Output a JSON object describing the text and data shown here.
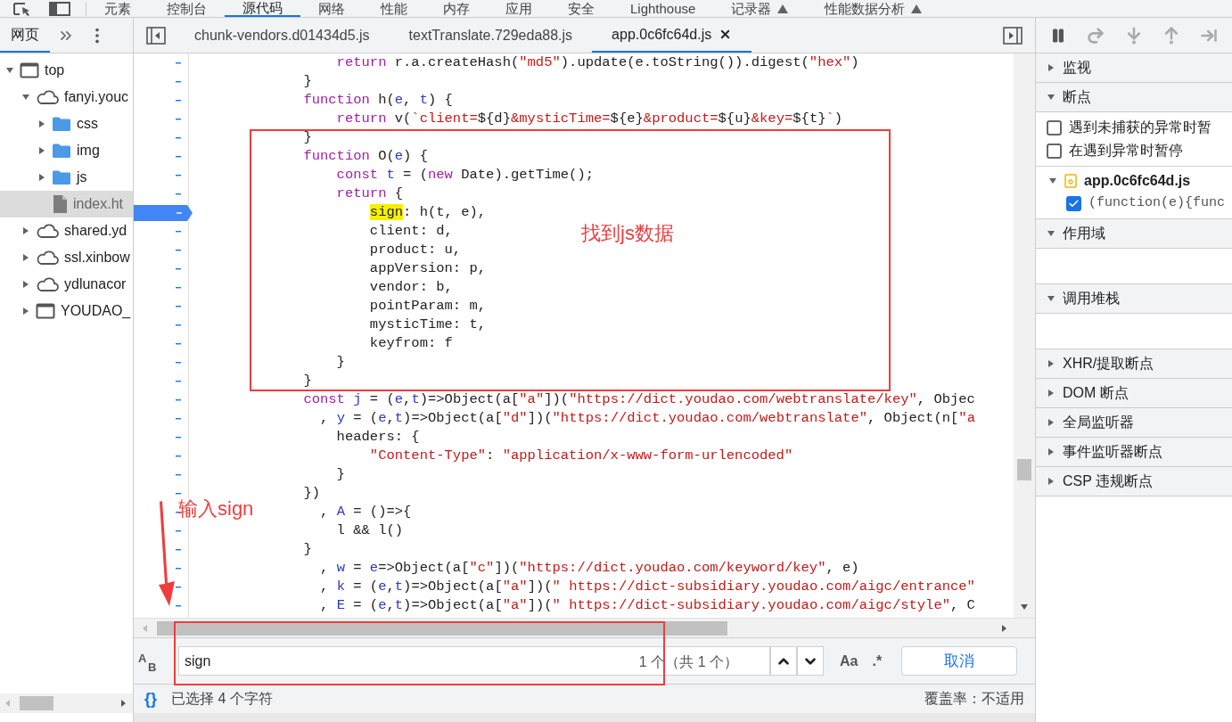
{
  "top_tabs": [
    {
      "label": "元素",
      "selected": false,
      "experimental": false
    },
    {
      "label": "控制台",
      "selected": false,
      "experimental": false
    },
    {
      "label": "源代码",
      "selected": true,
      "experimental": false
    },
    {
      "label": "网络",
      "selected": false,
      "experimental": false
    },
    {
      "label": "性能",
      "selected": false,
      "experimental": false
    },
    {
      "label": "内存",
      "selected": false,
      "experimental": false
    },
    {
      "label": "应用",
      "selected": false,
      "experimental": false
    },
    {
      "label": "安全",
      "selected": false,
      "experimental": false
    },
    {
      "label": "Lighthouse",
      "selected": false,
      "experimental": false
    },
    {
      "label": "记录器",
      "selected": false,
      "experimental": true
    },
    {
      "label": "性能数据分析",
      "selected": false,
      "experimental": true
    }
  ],
  "navigator": {
    "tabs": [
      {
        "label": "网页",
        "selected": true
      }
    ],
    "tree": [
      {
        "label": "top",
        "kind": "frame",
        "expanded": true,
        "selected": false,
        "children": [
          {
            "label": "fanyi.youc",
            "kind": "origin",
            "expanded": true,
            "selected": false,
            "children": [
              {
                "label": "css",
                "kind": "folder",
                "expanded": false,
                "selected": false
              },
              {
                "label": "img",
                "kind": "folder",
                "expanded": false,
                "selected": false
              },
              {
                "label": "js",
                "kind": "folder",
                "expanded": false,
                "selected": false
              },
              {
                "label": "index.ht",
                "kind": "file",
                "selected": true
              }
            ]
          },
          {
            "label": "shared.yd",
            "kind": "origin",
            "expanded": false,
            "selected": false
          },
          {
            "label": "ssl.xinbow",
            "kind": "origin",
            "expanded": false,
            "selected": false
          },
          {
            "label": "ydlunacor",
            "kind": "origin",
            "expanded": false,
            "selected": false
          },
          {
            "label": "YOUDAO_",
            "kind": "frame",
            "expanded": false,
            "selected": false
          }
        ]
      }
    ]
  },
  "editor": {
    "tabs": [
      {
        "label": "chunk-vendors.d01434d5.js",
        "selected": false,
        "closable": false
      },
      {
        "label": "textTranslate.729eda88.js",
        "selected": false,
        "closable": false
      },
      {
        "label": "app.0c6fc64d.js",
        "selected": true,
        "closable": true
      }
    ],
    "code": [
      {
        "breakpoint": false,
        "segments": [
          {
            "kind": "kw",
            "text": "            return"
          },
          {
            "kind": "plain",
            "text": " r.a.createHash("
          },
          {
            "kind": "str",
            "text": "\"md5\""
          },
          {
            "kind": "plain",
            "text": ").update(e.toString()).digest("
          },
          {
            "kind": "str",
            "text": "\"hex\""
          },
          {
            "kind": "plain",
            "text": ")"
          }
        ]
      },
      {
        "breakpoint": false,
        "segments": [
          {
            "kind": "plain",
            "text": "        }"
          }
        ]
      },
      {
        "breakpoint": false,
        "segments": [
          {
            "kind": "kw",
            "text": "        function"
          },
          {
            "kind": "plain",
            "text": " h("
          },
          {
            "kind": "def",
            "text": "e"
          },
          {
            "kind": "plain",
            "text": ", "
          },
          {
            "kind": "def",
            "text": "t"
          },
          {
            "kind": "plain",
            "text": ") {"
          }
        ]
      },
      {
        "breakpoint": false,
        "segments": [
          {
            "kind": "kw",
            "text": "            return"
          },
          {
            "kind": "plain",
            "text": " v("
          },
          {
            "kind": "str",
            "text": "`client="
          },
          {
            "kind": "plain",
            "text": "${d}"
          },
          {
            "kind": "str",
            "text": "&mysticTime="
          },
          {
            "kind": "plain",
            "text": "${e}"
          },
          {
            "kind": "str",
            "text": "&product="
          },
          {
            "kind": "plain",
            "text": "${u}"
          },
          {
            "kind": "str",
            "text": "&key="
          },
          {
            "kind": "plain",
            "text": "${t}"
          },
          {
            "kind": "str",
            "text": "`"
          },
          {
            "kind": "plain",
            "text": ")"
          }
        ]
      },
      {
        "breakpoint": false,
        "segments": [
          {
            "kind": "plain",
            "text": "        }"
          }
        ]
      },
      {
        "breakpoint": false,
        "segments": [
          {
            "kind": "kw",
            "text": "        function"
          },
          {
            "kind": "plain",
            "text": " O("
          },
          {
            "kind": "def",
            "text": "e"
          },
          {
            "kind": "plain",
            "text": ") {"
          }
        ]
      },
      {
        "breakpoint": false,
        "segments": [
          {
            "kind": "kw",
            "text": "            const"
          },
          {
            "kind": "def",
            "text": " t"
          },
          {
            "kind": "plain",
            "text": " = ("
          },
          {
            "kind": "kw",
            "text": "new"
          },
          {
            "kind": "plain",
            "text": " Date).getTime();"
          }
        ]
      },
      {
        "breakpoint": false,
        "segments": [
          {
            "kind": "kw",
            "text": "            return"
          },
          {
            "kind": "plain",
            "text": " {"
          }
        ]
      },
      {
        "breakpoint": true,
        "segments": [
          {
            "kind": "match",
            "text": "                sign"
          },
          {
            "kind": "plain",
            "text": ": h(t, e),"
          }
        ]
      },
      {
        "breakpoint": false,
        "segments": [
          {
            "kind": "plain",
            "text": "                client: d,"
          }
        ]
      },
      {
        "breakpoint": false,
        "segments": [
          {
            "kind": "plain",
            "text": "                product: u,"
          }
        ]
      },
      {
        "breakpoint": false,
        "segments": [
          {
            "kind": "plain",
            "text": "                appVersion: p,"
          }
        ]
      },
      {
        "breakpoint": false,
        "segments": [
          {
            "kind": "plain",
            "text": "                vendor: b,"
          }
        ]
      },
      {
        "breakpoint": false,
        "segments": [
          {
            "kind": "plain",
            "text": "                pointParam: m,"
          }
        ]
      },
      {
        "breakpoint": false,
        "segments": [
          {
            "kind": "plain",
            "text": "                mysticTime: t,"
          }
        ]
      },
      {
        "breakpoint": false,
        "segments": [
          {
            "kind": "plain",
            "text": "                keyfrom: f"
          }
        ]
      },
      {
        "breakpoint": false,
        "segments": [
          {
            "kind": "plain",
            "text": "            }"
          }
        ]
      },
      {
        "breakpoint": false,
        "segments": [
          {
            "kind": "plain",
            "text": "        }"
          }
        ]
      },
      {
        "breakpoint": false,
        "segments": [
          {
            "kind": "kw",
            "text": "        const"
          },
          {
            "kind": "def",
            "text": " j"
          },
          {
            "kind": "plain",
            "text": " = ("
          },
          {
            "kind": "def",
            "text": "e"
          },
          {
            "kind": "plain",
            "text": ","
          },
          {
            "kind": "def",
            "text": "t"
          },
          {
            "kind": "plain",
            "text": ")=>Object(a["
          },
          {
            "kind": "str",
            "text": "\"a\""
          },
          {
            "kind": "plain",
            "text": "])("
          },
          {
            "kind": "str",
            "text": "\"https://dict.youdao.com/webtranslate/key\""
          },
          {
            "kind": "plain",
            "text": ", Objec"
          }
        ]
      },
      {
        "breakpoint": false,
        "segments": [
          {
            "kind": "plain",
            "text": "          , "
          },
          {
            "kind": "def",
            "text": "y"
          },
          {
            "kind": "plain",
            "text": " = ("
          },
          {
            "kind": "def",
            "text": "e"
          },
          {
            "kind": "plain",
            "text": ","
          },
          {
            "kind": "def",
            "text": "t"
          },
          {
            "kind": "plain",
            "text": ")=>Object(a["
          },
          {
            "kind": "str",
            "text": "\"d\""
          },
          {
            "kind": "plain",
            "text": "])("
          },
          {
            "kind": "str",
            "text": "\"https://dict.youdao.com/webtranslate\""
          },
          {
            "kind": "plain",
            "text": ", Object(n["
          },
          {
            "kind": "str",
            "text": "\"a"
          }
        ]
      },
      {
        "breakpoint": false,
        "segments": [
          {
            "kind": "plain",
            "text": "            headers: {"
          }
        ]
      },
      {
        "breakpoint": false,
        "segments": [
          {
            "kind": "str",
            "text": "                \"Content-Type\""
          },
          {
            "kind": "plain",
            "text": ": "
          },
          {
            "kind": "str",
            "text": "\"application/x-www-form-urlencoded\""
          }
        ]
      },
      {
        "breakpoint": false,
        "segments": [
          {
            "kind": "plain",
            "text": "            }"
          }
        ]
      },
      {
        "breakpoint": false,
        "segments": [
          {
            "kind": "plain",
            "text": "        })"
          }
        ]
      },
      {
        "breakpoint": false,
        "segments": [
          {
            "kind": "plain",
            "text": "          , "
          },
          {
            "kind": "def",
            "text": "A"
          },
          {
            "kind": "plain",
            "text": " = ()=>{"
          }
        ]
      },
      {
        "breakpoint": false,
        "segments": [
          {
            "kind": "plain",
            "text": "            l && l()"
          }
        ]
      },
      {
        "breakpoint": false,
        "segments": [
          {
            "kind": "plain",
            "text": "        }"
          }
        ]
      },
      {
        "breakpoint": false,
        "segments": [
          {
            "kind": "plain",
            "text": "          , "
          },
          {
            "kind": "def",
            "text": "w"
          },
          {
            "kind": "plain",
            "text": " = "
          },
          {
            "kind": "def",
            "text": "e"
          },
          {
            "kind": "plain",
            "text": "=>Object(a["
          },
          {
            "kind": "str",
            "text": "\"c\""
          },
          {
            "kind": "plain",
            "text": "])("
          },
          {
            "kind": "str",
            "text": "\"https://dict.youdao.com/keyword/key\""
          },
          {
            "kind": "plain",
            "text": ", e)"
          }
        ]
      },
      {
        "breakpoint": false,
        "segments": [
          {
            "kind": "plain",
            "text": "          , "
          },
          {
            "kind": "def",
            "text": "k"
          },
          {
            "kind": "plain",
            "text": " = ("
          },
          {
            "kind": "def",
            "text": "e"
          },
          {
            "kind": "plain",
            "text": ","
          },
          {
            "kind": "def",
            "text": "t"
          },
          {
            "kind": "plain",
            "text": ")=>Object(a["
          },
          {
            "kind": "str",
            "text": "\"a\""
          },
          {
            "kind": "plain",
            "text": "])("
          },
          {
            "kind": "str",
            "text": "\" https://dict-subsidiary.youdao.com/aigc/entrance\""
          }
        ]
      },
      {
        "breakpoint": false,
        "segments": [
          {
            "kind": "plain",
            "text": "          , "
          },
          {
            "kind": "def",
            "text": "E"
          },
          {
            "kind": "plain",
            "text": " = ("
          },
          {
            "kind": "def",
            "text": "e"
          },
          {
            "kind": "plain",
            "text": ","
          },
          {
            "kind": "def",
            "text": "t"
          },
          {
            "kind": "plain",
            "text": ")=>Object(a["
          },
          {
            "kind": "str",
            "text": "\"a\""
          },
          {
            "kind": "plain",
            "text": "])("
          },
          {
            "kind": "str",
            "text": "\" https://dict-subsidiary.youdao.com/aigc/style\""
          },
          {
            "kind": "plain",
            "text": ", C"
          }
        ]
      }
    ],
    "search": {
      "replace_toggle": "AB",
      "value": "sign",
      "match_count": "1 个（共 1 个）",
      "match_case": "Aa",
      "regex": ".*",
      "cancel": "取消"
    },
    "status": {
      "pretty_print": "{}",
      "selection": "已选择 4 个字符",
      "coverage": "覆盖率：不适用"
    }
  },
  "debugger": {
    "sections": [
      {
        "title": "监视",
        "expanded": false
      },
      {
        "kind": "breakpoints",
        "title": "断点",
        "expanded": true,
        "options": [
          {
            "label": "遇到未捕获的异常时暂",
            "checked": false
          },
          {
            "label": "在遇到异常时暂停",
            "checked": false
          }
        ],
        "files": [
          {
            "name": "app.0c6fc64d.js",
            "expanded": true,
            "breakpoints": [
              {
                "code": "(function(e){func",
                "checked": true
              }
            ]
          }
        ]
      },
      {
        "kind": "empty",
        "title": "作用域",
        "expanded": true
      },
      {
        "kind": "empty",
        "title": "调用堆栈",
        "expanded": true
      },
      {
        "title": "XHR/提取断点",
        "expanded": false
      },
      {
        "title": "DOM 断点",
        "expanded": false
      },
      {
        "title": "全局监听器",
        "expanded": false
      },
      {
        "title": "事件监听器断点",
        "expanded": false
      },
      {
        "title": "CSP 违规断点",
        "expanded": false
      }
    ]
  },
  "annotations": {
    "labels": [
      "找到js数据",
      "输入sign"
    ]
  }
}
